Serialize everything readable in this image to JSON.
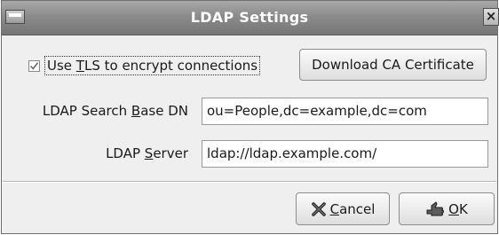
{
  "window": {
    "title": "LDAP Settings",
    "close_glyph": "×"
  },
  "tls": {
    "checked": true,
    "label_pre": "Use ",
    "label_mnemonic": "T",
    "label_post": "LS to encrypt connections"
  },
  "ca_button": {
    "label": "Download CA Certificate"
  },
  "base_dn": {
    "label_pre": "LDAP Search ",
    "label_mnemonic": "B",
    "label_post": "ase DN",
    "value": "ou=People,dc=example,dc=com"
  },
  "server": {
    "label_pre": "LDAP ",
    "label_mnemonic": "S",
    "label_post": "erver",
    "value": "ldap://ldap.example.com/"
  },
  "buttons": {
    "cancel_mnemonic": "C",
    "cancel_rest": "ancel",
    "cancel_icon": "cancel-x-icon",
    "ok_mnemonic": "O",
    "ok_rest": "K",
    "ok_icon": "ok-hand-icon"
  }
}
